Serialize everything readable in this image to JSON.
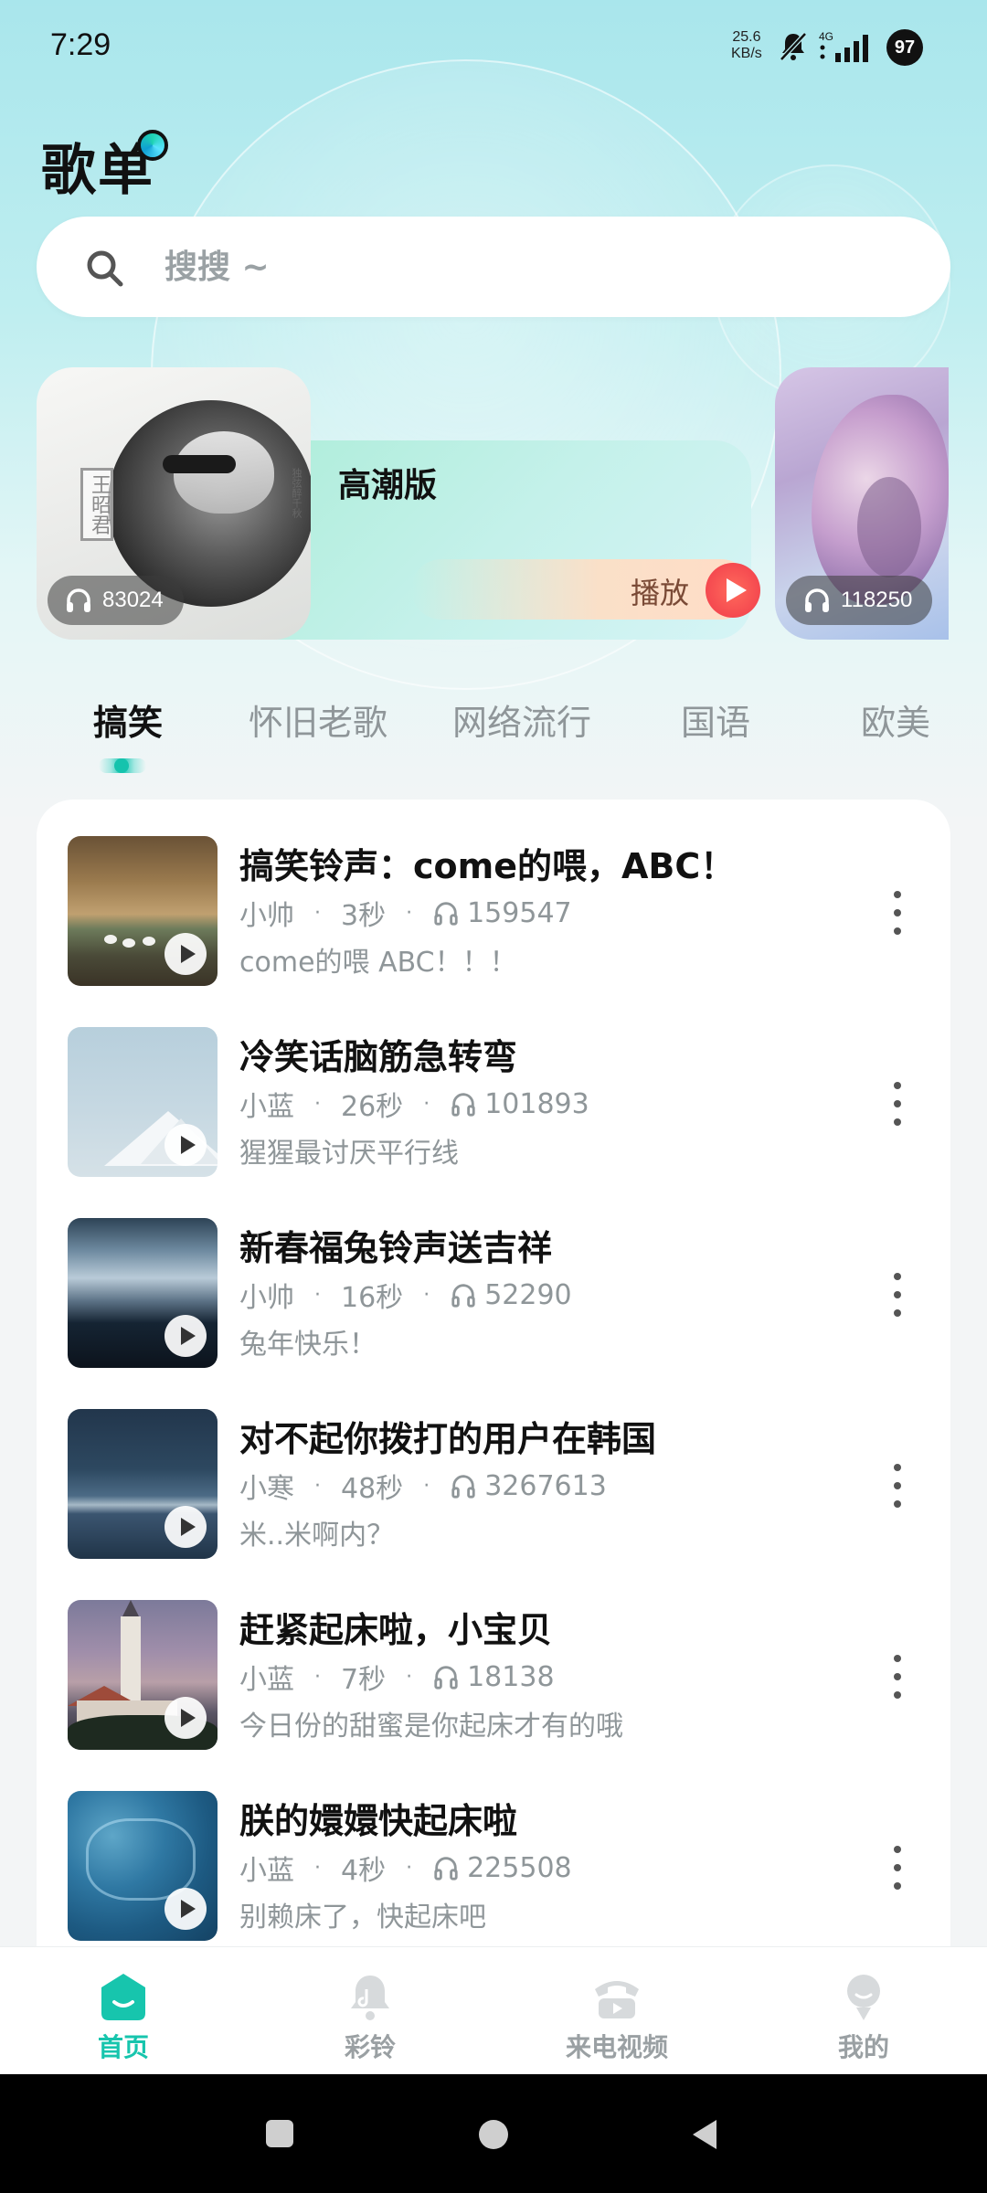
{
  "status_bar": {
    "time": "7:29",
    "net_speed_value": "25.6",
    "net_speed_unit": "KB/s",
    "network_type": "4G",
    "battery": "97"
  },
  "header": {
    "title": "歌单"
  },
  "search": {
    "placeholder": "搜搜 ~"
  },
  "featured": [
    {
      "title": "高潮版",
      "play_count": "83024",
      "play_label": "播放",
      "cover_seal": "王昭君",
      "cover_side_text": "独弦醉千秋"
    },
    {
      "play_count": "118250"
    }
  ],
  "tabs": [
    {
      "label": "搞笑",
      "active": true
    },
    {
      "label": "怀旧老歌",
      "active": false
    },
    {
      "label": "网络流行",
      "active": false
    },
    {
      "label": "国语",
      "active": false
    },
    {
      "label": "欧美",
      "active": false
    }
  ],
  "songs": [
    {
      "title": "搞笑铃声：come的喂，ABC！",
      "author": "小帅",
      "duration": "3秒",
      "plays": "159547",
      "desc": "come的喂 ABC！！！"
    },
    {
      "title": "冷笑话脑筋急转弯",
      "author": "小蓝",
      "duration": "26秒",
      "plays": "101893",
      "desc": "猩猩最讨厌平行线"
    },
    {
      "title": "新春福兔铃声送吉祥",
      "author": "小帅",
      "duration": "16秒",
      "plays": "52290",
      "desc": "兔年快乐！"
    },
    {
      "title": "对不起你拨打的用户在韩国",
      "author": "小寒",
      "duration": "48秒",
      "plays": "3267613",
      "desc": "米..米啊内？"
    },
    {
      "title": "赶紧起床啦，小宝贝",
      "author": "小蓝",
      "duration": "7秒",
      "plays": "18138",
      "desc": "今日份的甜蜜是你起床才有的哦"
    },
    {
      "title": "朕的嬛嬛快起床啦",
      "author": "小蓝",
      "duration": "4秒",
      "plays": "225508",
      "desc": "别赖床了，快起床吧"
    }
  ],
  "meta_separator": "·",
  "bottom_nav": [
    {
      "label": "首页",
      "icon": "home-icon",
      "active": true
    },
    {
      "label": "彩铃",
      "icon": "bell-icon",
      "active": false
    },
    {
      "label": "来电视频",
      "icon": "phone-icon",
      "active": false
    },
    {
      "label": "我的",
      "icon": "profile-icon",
      "active": false
    }
  ],
  "colors": {
    "accent": "#17c5ad",
    "play_red": "#f03b4a",
    "muted_text": "#8f9699"
  }
}
